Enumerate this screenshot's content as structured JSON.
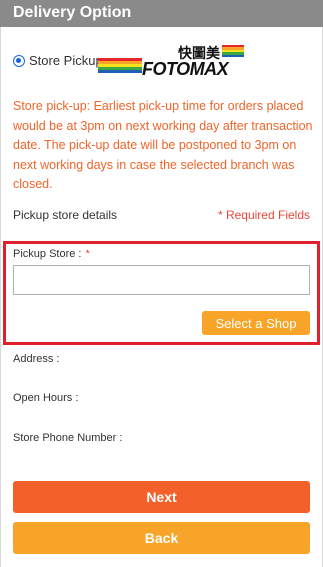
{
  "header": {
    "title": "Delivery Option"
  },
  "delivery": {
    "option_label": "Store Pickup",
    "logo": {
      "chinese": "快圖美",
      "english": "FOTOMAX",
      "stripe_colors": [
        "#e5232b",
        "#f7a428",
        "#f4e01c",
        "#3aa845",
        "#1e5db8"
      ]
    }
  },
  "notice": "Store pick-up: Earliest pick-up time for orders placed would be at 3pm on next working day after transaction date. The pick-up date will be postponed to 3pm on next working days in case the selected branch was closed.",
  "pickup": {
    "section_title": "Pickup store details",
    "required_note": "* Required Fields",
    "store_label": "Pickup Store :",
    "store_required_mark": "*",
    "store_value": "",
    "select_button": "Select a Shop"
  },
  "store_info": {
    "address_label": "Address :",
    "hours_label": "Open Hours :",
    "phone_label": "Store Phone Number :"
  },
  "actions": {
    "next": "Next",
    "back": "Back"
  },
  "colors": {
    "header_bg": "#8a8a8a",
    "notice": "#f0652a",
    "next_button": "#f4602a",
    "select_button": "#f7a428",
    "highlight_border": "#e0202a"
  }
}
